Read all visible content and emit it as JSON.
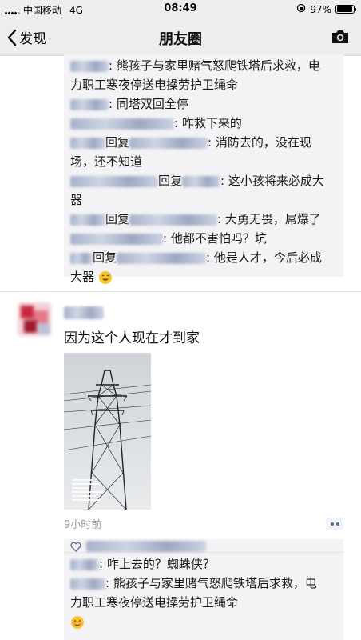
{
  "status_bar": {
    "carrier": "中国移动",
    "network": "4G",
    "time": "08:49",
    "battery": "97%",
    "battery_level": 0.97
  },
  "nav": {
    "back_label": "发现",
    "title": "朋友圈"
  },
  "top_comments": [
    {
      "id": "c1",
      "sep": ": ",
      "text": "熊孩子与家里赌气怒爬铁塔后求救，电"
    },
    {
      "id": "c1b",
      "text": "力职工寒夜停送电操劳护卫绳命"
    },
    {
      "id": "c2",
      "sep": ": ",
      "text": "同塔双回全停"
    },
    {
      "id": "c3",
      "sep": ": ",
      "text": "咋救下来的"
    },
    {
      "id": "c4",
      "reply": "回复",
      "sep": ": ",
      "text": "消防去的，没在现"
    },
    {
      "id": "c4b",
      "text": "场，还不知道"
    },
    {
      "id": "c5",
      "reply": "回复",
      "sep": ": ",
      "text": "这小孩将来必成大"
    },
    {
      "id": "c5b",
      "text": "器"
    },
    {
      "id": "c6",
      "reply": "回复",
      "sep": ": ",
      "text": "大勇无畏，屌爆了"
    },
    {
      "id": "c7",
      "sep": ": ",
      "text": "他都不害怕吗？坑"
    },
    {
      "id": "c8",
      "reply": "回复",
      "sep": ": ",
      "text": "他是人才，今后必成"
    },
    {
      "id": "c8b",
      "text": "大器"
    }
  ],
  "post": {
    "text": "因为这个人现在才到家",
    "time": "9小时前",
    "photo_alt": "tower-photo"
  },
  "bottom_comments": [
    {
      "id": "b1",
      "sep": ": ",
      "text": "咋上去的？蜘蛛侠？"
    },
    {
      "id": "b2",
      "sep": ": ",
      "text": "熊孩子与家里赌气怒爬铁塔后求救，电"
    },
    {
      "id": "b2b",
      "text": "力职工寒夜停送电操劳护卫绳命"
    }
  ],
  "icons": {
    "back": "chevron-left-icon",
    "camera": "camera-icon",
    "like": "heart-outline-icon",
    "more": "more-dots-icon"
  },
  "colors": {
    "name_blue": "#576b95",
    "bar_bg": "#ededed",
    "comment_bg": "#f3f3f5"
  }
}
